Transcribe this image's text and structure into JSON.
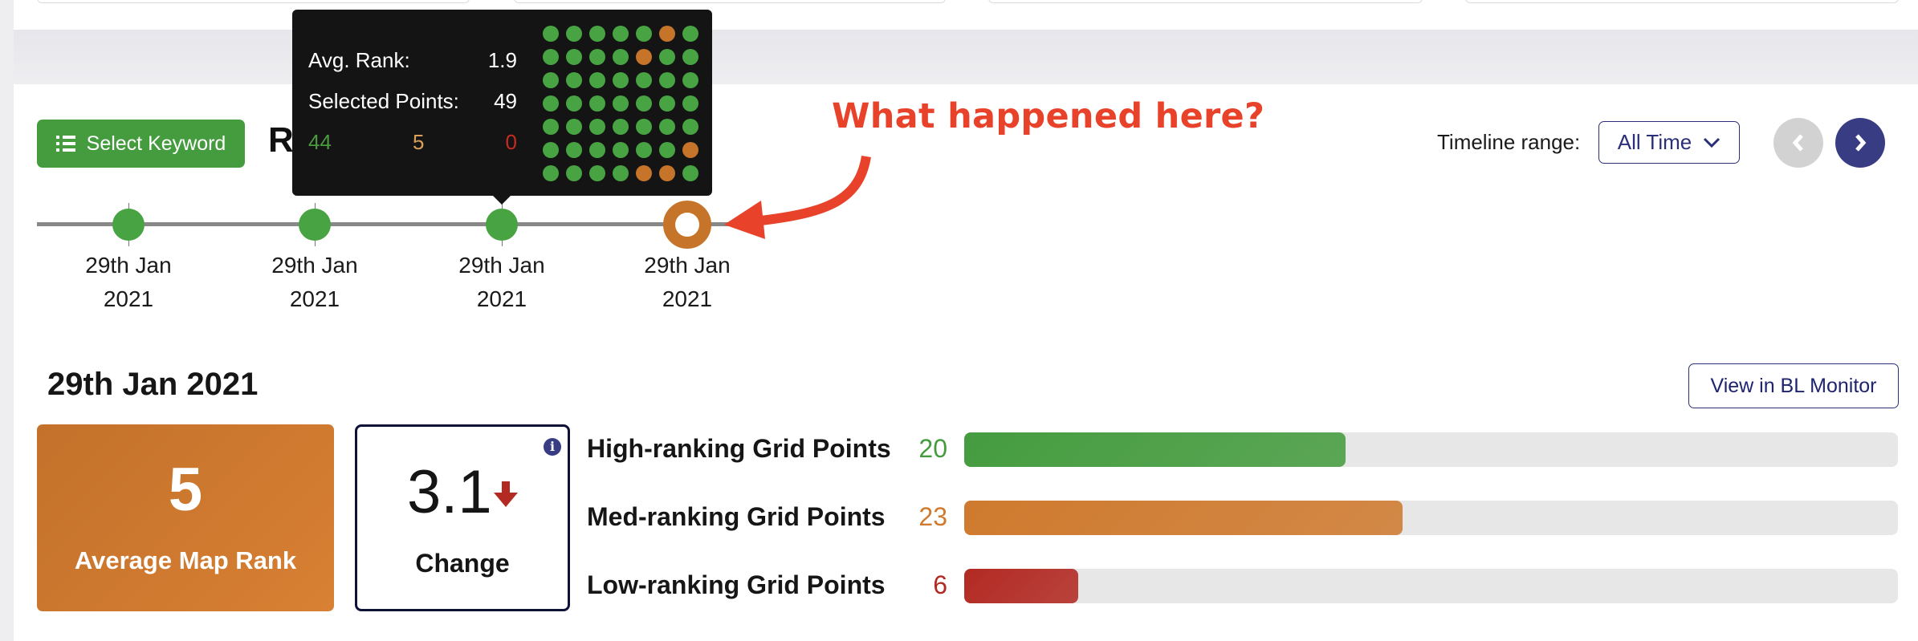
{
  "top_cards_count": 4,
  "header": {
    "select_keyword_label": "Select Keyword",
    "report_title_partial": "R",
    "timeline_range_label": "Timeline range:",
    "timeline_range_value": "All Time",
    "prev_icon": "chevron-left-icon",
    "next_icon": "chevron-right-icon"
  },
  "timeline": {
    "points": [
      {
        "date_line1": "29th Jan",
        "date_line2": "2021",
        "status": "high",
        "selected": false
      },
      {
        "date_line1": "29th Jan",
        "date_line2": "2021",
        "status": "high",
        "selected": false
      },
      {
        "date_line1": "29th Jan",
        "date_line2": "2021",
        "status": "high",
        "selected": false
      },
      {
        "date_line1": "29th Jan",
        "date_line2": "2021",
        "status": "medium",
        "selected": true
      }
    ]
  },
  "tooltip": {
    "avg_rank_label": "Avg. Rank:",
    "avg_rank_value": "1.9",
    "selected_points_label": "Selected Points:",
    "selected_points_value": "49",
    "high_count": "44",
    "med_count": "5",
    "low_count": "0",
    "grid": [
      [
        "h",
        "h",
        "h",
        "h",
        "h",
        "m",
        "h"
      ],
      [
        "h",
        "h",
        "h",
        "h",
        "m",
        "h",
        "h"
      ],
      [
        "h",
        "h",
        "h",
        "h",
        "h",
        "h",
        "h"
      ],
      [
        "h",
        "h",
        "h",
        "h",
        "h",
        "h",
        "h"
      ],
      [
        "h",
        "h",
        "h",
        "h",
        "h",
        "h",
        "h"
      ],
      [
        "h",
        "h",
        "h",
        "h",
        "h",
        "h",
        "m"
      ],
      [
        "h",
        "h",
        "h",
        "h",
        "m",
        "m",
        "h"
      ]
    ]
  },
  "annotation": {
    "text": "What happened here?",
    "color": "#e8432a"
  },
  "summary": {
    "date_title": "29th Jan 2021",
    "view_button_label": "View in BL Monitor",
    "average_map_rank_value": "5",
    "average_map_rank_label": "Average Map Rank",
    "change_value": "3.1",
    "change_direction": "down",
    "change_label": "Change",
    "info_icon": "info-icon"
  },
  "grid_points": {
    "total": 49,
    "rows": [
      {
        "label": "High-ranking Grid Points",
        "value": "20",
        "count": 20,
        "color": "#459c3f"
      },
      {
        "label": "Med-ranking Grid Points",
        "value": "23",
        "count": 23,
        "color": "#cf7a2e"
      },
      {
        "label": "Low-ranking Grid Points",
        "value": "6",
        "count": 6,
        "color": "#b22a22"
      }
    ]
  },
  "colors": {
    "high": "#48a443",
    "medium": "#c5742a",
    "low": "#b22a22",
    "navy": "#383c82",
    "tooltip_high_text": "#4a9a3e",
    "tooltip_med_text": "#d9a05a",
    "tooltip_low_text": "#c62b22"
  }
}
